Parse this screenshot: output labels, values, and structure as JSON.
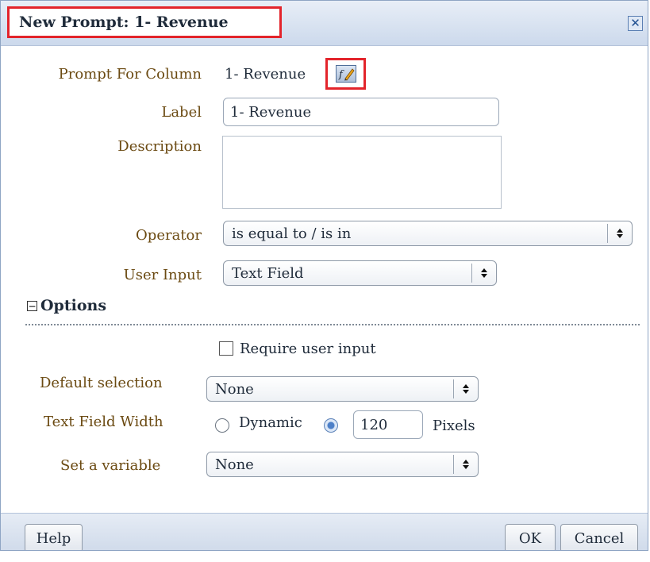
{
  "dialog": {
    "title": "New Prompt: 1- Revenue",
    "close_icon": "close-icon"
  },
  "form": {
    "prompt_for_column_label": "Prompt For Column",
    "prompt_for_column_value": "1- Revenue",
    "edit_formula_icon": "edit-formula-icon",
    "label_label": "Label",
    "label_value": "1- Revenue",
    "description_label": "Description",
    "description_value": "",
    "operator_label": "Operator",
    "operator_value": "is equal to / is in",
    "user_input_label": "User Input",
    "user_input_value": "Text Field"
  },
  "options": {
    "section_title": "Options",
    "toggle_symbol": "−",
    "require_user_input_label": "Require user input",
    "require_user_input_checked": false,
    "default_selection_label": "Default selection",
    "default_selection_value": "None",
    "text_field_width_label": "Text Field Width",
    "dynamic_label": "Dynamic",
    "width_value": "120",
    "pixels_label": "Pixels",
    "width_mode_selected": "pixels",
    "set_variable_label": "Set a variable",
    "set_variable_value": "None"
  },
  "footer": {
    "help_label": "Help",
    "ok_label": "OK",
    "cancel_label": "Cancel"
  },
  "colors": {
    "highlight": "#e3242b",
    "label_text": "#6b4a12",
    "title_bar": "#ccd9ec"
  }
}
